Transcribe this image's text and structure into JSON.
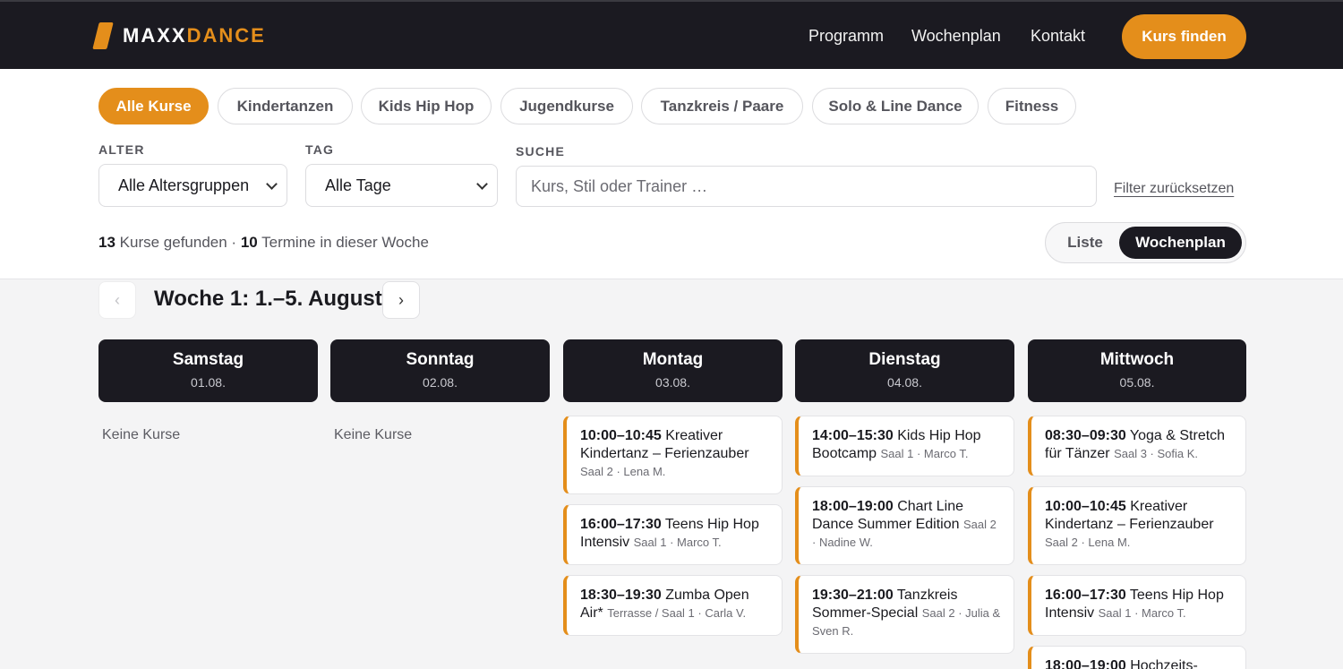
{
  "brand": {
    "name_part1": "MAXX",
    "name_part2": "DANCE",
    "accent_color": "#e48e1b",
    "dark_color": "#1b1a21"
  },
  "nav": {
    "items": [
      "Programm",
      "Wochenplan",
      "Kontakt"
    ],
    "cta": "Kurs finden"
  },
  "categories": [
    "Alle Kurse",
    "Kindertanzen",
    "Kids Hip Hop",
    "Jugendkurse",
    "Tanzkreis / Paare",
    "Solo & Line Dance",
    "Fitness"
  ],
  "filters": {
    "age": {
      "label": "ALTER",
      "value": "Alle Altersgruppen"
    },
    "day": {
      "label": "TAG",
      "value": "Alle Tage"
    },
    "search": {
      "label": "SUCHE",
      "placeholder": "Kurs, Stil oder Trainer …"
    },
    "reset": "Filter zurücksetzen"
  },
  "results": {
    "courses": "13",
    "courses_text": "Kurse gefunden ·",
    "dates": "10",
    "dates_text": "Termine in dieser Woche"
  },
  "view_toggle": {
    "list": "Liste",
    "week": "Wochenplan",
    "active": "Wochenplan"
  },
  "week": {
    "title": "Woche 1: 1.–5. August",
    "prev": "‹",
    "next": "›"
  },
  "days": [
    {
      "name": "Samstag",
      "date": "01.08.",
      "empty_text": "Keine Kurse",
      "courses": []
    },
    {
      "name": "Sonntag",
      "date": "02.08.",
      "empty_text": "Keine Kurse",
      "courses": []
    },
    {
      "name": "Montag",
      "date": "03.08.",
      "courses": [
        {
          "time": "10:00–10:45",
          "title": "Kreativer Kindertanz – Ferienzauber",
          "meta": "Saal 2 · Lena M."
        },
        {
          "time": "16:00–17:30",
          "title": "Teens Hip Hop Intensiv",
          "meta": "Saal 1 · Marco T."
        },
        {
          "time": "18:30–19:30",
          "title": "Zumba Open Air*",
          "meta": "Terrasse / Saal 1 · Carla V."
        }
      ]
    },
    {
      "name": "Dienstag",
      "date": "04.08.",
      "courses": [
        {
          "time": "14:00–15:30",
          "title": "Kids Hip Hop Bootcamp",
          "meta": "Saal 1 · Marco T."
        },
        {
          "time": "18:00–19:00",
          "title": "Chart Line Dance Summer Edition",
          "meta": "Saal 2 · Nadine W."
        },
        {
          "time": "19:30–21:00",
          "title": "Tanzkreis Sommer-Special",
          "meta": "Saal 2 · Julia & Sven R."
        }
      ]
    },
    {
      "name": "Mittwoch",
      "date": "05.08.",
      "courses": [
        {
          "time": "08:30–09:30",
          "title": "Yoga & Stretch für Tänzer",
          "meta": "Saal 3 · Sofia K."
        },
        {
          "time": "10:00–10:45",
          "title": "Kreativer Kindertanz – Ferienzauber",
          "meta": "Saal 2 · Lena M."
        },
        {
          "time": "16:00–17:30",
          "title": "Teens Hip Hop Intensiv",
          "meta": "Saal 1 · Marco T."
        },
        {
          "time": "18:00–19:00",
          "title": "Hochzeits-",
          "meta": ""
        }
      ]
    }
  ]
}
